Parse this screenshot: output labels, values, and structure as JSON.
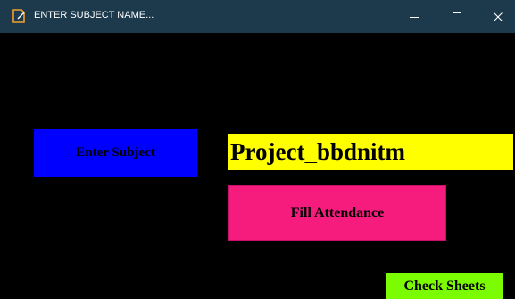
{
  "window": {
    "title": "ENTER SUBJECT NAME...",
    "titlebar_color": "#1c3a4b",
    "icons": {
      "app": "app-icon",
      "minimize": "minimize-icon",
      "maximize": "maximize-icon",
      "close": "close-icon"
    }
  },
  "main": {
    "background": "#000000",
    "enter_subject": {
      "label": "Enter Subject",
      "color": "#0000ff"
    },
    "subject_input": {
      "value": "Project_bbdnitm",
      "color": "#ffff00"
    },
    "fill_attendance": {
      "label": "Fill Attendance",
      "color": "#f61c7d"
    },
    "check_sheets": {
      "label": "Check Sheets",
      "color": "#7cfc00"
    }
  }
}
